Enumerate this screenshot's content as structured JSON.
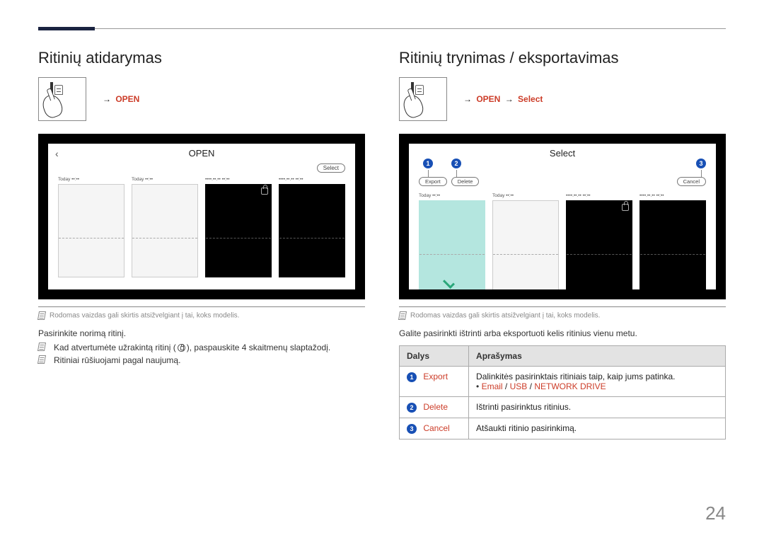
{
  "pageNumber": "24",
  "left": {
    "title": "Ritinių atidarymas",
    "path": {
      "arrow": "→",
      "open": "OPEN"
    },
    "screen": {
      "back": "‹",
      "header": "OPEN",
      "selectBtn": "Select",
      "rolls": [
        {
          "label": "Today ••:••"
        },
        {
          "label": "Today ••:••"
        },
        {
          "label": "••••.••.•• ••:••"
        },
        {
          "label": "••••.••.•• ••:••"
        }
      ]
    },
    "note": "Rodomas vaizdas gali skirtis atsižvelgiant į tai, koks modelis.",
    "body": "Pasirinkite norimą ritinį.",
    "bullet1a": "Kad atvertumėte užrakintą ritinį (",
    "bullet1b": "), paspauskite 4 skaitmenų slaptažodį.",
    "bullet2": "Ritiniai rūšiuojami pagal naujumą."
  },
  "right": {
    "title": "Ritinių trynimas / eksportavimas",
    "path": {
      "arrow": "→",
      "open": "OPEN",
      "select": "Select"
    },
    "screen": {
      "header": "Select",
      "exportBtn": "Export",
      "deleteBtn": "Delete",
      "cancelBtn": "Cancel",
      "callouts": {
        "c1": "1",
        "c2": "2",
        "c3": "3"
      },
      "rolls": [
        {
          "label": "Today ••:••"
        },
        {
          "label": "Today ••:••"
        },
        {
          "label": "••••.••.•• ••:••"
        },
        {
          "label": "••••.••.•• ••:••"
        }
      ]
    },
    "note": "Rodomas vaizdas gali skirtis atsižvelgiant į tai, koks modelis.",
    "body": "Galite pasirinkti ištrinti arba eksportuoti kelis ritinius vienu metu.",
    "table": {
      "headers": {
        "parts": "Dalys",
        "desc": "Aprašymas"
      },
      "rows": [
        {
          "num": "1",
          "label": "Export",
          "desc1": "Dalinkitės pasirinktais ritiniais taip, kaip jums patinka.",
          "desc2_email": "Email",
          "desc2_sep": " / ",
          "desc2_usb": "USB",
          "desc2_net": "NETWORK DRIVE"
        },
        {
          "num": "2",
          "label": "Delete",
          "desc": "Ištrinti pasirinktus ritinius."
        },
        {
          "num": "3",
          "label": "Cancel",
          "desc": "Atšaukti ritinio pasirinkimą."
        }
      ]
    }
  }
}
